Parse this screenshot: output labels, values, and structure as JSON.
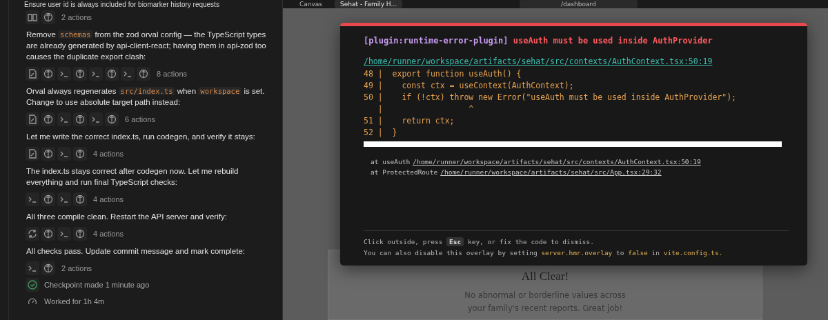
{
  "chat": {
    "title": "Ensure user id is always included for biomarker history requests",
    "feed": [
      {
        "kind": "actions",
        "icons": [
          {
            "kind": "book"
          },
          {
            "kind": "agent"
          }
        ],
        "count": "2 actions"
      },
      {
        "kind": "message",
        "parts": [
          {
            "text": "Remove ",
            "code": false
          },
          {
            "text": "schemas",
            "code": true
          },
          {
            "text": " from the zod orval config — the TypeScript types are already generated by api-client-react; having them in api-zod too causes the duplicate export clash:",
            "code": false
          }
        ]
      },
      {
        "kind": "actions",
        "icons": [
          {
            "kind": "file"
          },
          {
            "kind": "agent"
          },
          {
            "kind": "terminal"
          },
          {
            "kind": "agent"
          },
          {
            "kind": "terminal"
          },
          {
            "kind": "agent"
          },
          {
            "kind": "terminal"
          },
          {
            "kind": "agent"
          }
        ],
        "count": "8 actions"
      },
      {
        "kind": "message",
        "parts": [
          {
            "text": "Orval always regenerates ",
            "code": false
          },
          {
            "text": "src/index.ts",
            "code": true
          },
          {
            "text": " when ",
            "code": false
          },
          {
            "text": "workspace",
            "code": true
          },
          {
            "text": " is set. Change to use absolute target path instead:",
            "code": false
          }
        ]
      },
      {
        "kind": "actions",
        "icons": [
          {
            "kind": "file"
          },
          {
            "kind": "agent"
          },
          {
            "kind": "terminal"
          },
          {
            "kind": "agent"
          },
          {
            "kind": "terminal"
          },
          {
            "kind": "agent"
          }
        ],
        "count": "6 actions"
      },
      {
        "kind": "message",
        "parts": [
          {
            "text": "Let me write the correct index.ts, run codegen, and verify it stays:",
            "code": false
          }
        ]
      },
      {
        "kind": "actions",
        "icons": [
          {
            "kind": "file"
          },
          {
            "kind": "agent"
          },
          {
            "kind": "terminal"
          },
          {
            "kind": "agent"
          }
        ],
        "count": "4 actions"
      },
      {
        "kind": "message",
        "parts": [
          {
            "text": "The index.ts stays correct after codegen now. Let me rebuild everything and run final TypeScript checks:",
            "code": false
          }
        ]
      },
      {
        "kind": "actions",
        "icons": [
          {
            "kind": "terminal"
          },
          {
            "kind": "agent"
          },
          {
            "kind": "terminal"
          },
          {
            "kind": "agent"
          }
        ],
        "count": "4 actions"
      },
      {
        "kind": "message",
        "parts": [
          {
            "text": "All three compile clean. Restart the API server and verify:",
            "code": false
          }
        ]
      },
      {
        "kind": "actions",
        "icons": [
          {
            "kind": "restart"
          },
          {
            "kind": "agent"
          },
          {
            "kind": "terminal"
          },
          {
            "kind": "agent"
          }
        ],
        "count": "4 actions"
      },
      {
        "kind": "message",
        "parts": [
          {
            "text": "All checks pass. Update commit message and mark complete:",
            "code": false
          }
        ]
      },
      {
        "kind": "actions",
        "icons": [
          {
            "kind": "terminal"
          },
          {
            "kind": "agent"
          }
        ],
        "count": "2 actions"
      },
      {
        "kind": "checkpoint",
        "text": "Checkpoint made 1 minute ago"
      },
      {
        "kind": "worked",
        "text": "Worked for 1h 4m"
      }
    ]
  },
  "browser": {
    "tabs": [
      {
        "label": "Canvas",
        "selected": false
      },
      {
        "label": "Sehat - Family H...",
        "selected": true
      }
    ],
    "url": "/dashboard"
  },
  "error_overlay": {
    "plugin": "[plugin:runtime-error-plugin]",
    "message": "useAuth must be used inside AuthProvider",
    "file": "/home/runner/workspace/artifacts/sehat/src/contexts/AuthContext.tsx:50:19",
    "code_lines": [
      "48 |  export function useAuth() {",
      "49 |    const ctx = useContext(AuthContext);",
      "50 |    if (!ctx) throw new Error(\"useAuth must be used inside AuthProvider\");",
      "   |                  ^",
      "51 |    return ctx;",
      "52 |  }"
    ],
    "stack": [
      {
        "at": "at useAuth",
        "link": "/home/runner/workspace/artifacts/sehat/src/contexts/AuthContext.tsx:50:19"
      },
      {
        "at": "at ProtectedRoute",
        "link": "/home/runner/workspace/artifacts/sehat/src/App.tsx:29:32"
      }
    ],
    "tips": [
      [
        {
          "kind": "text",
          "text": "Click outside, press "
        },
        {
          "kind": "kbd",
          "text": "Esc"
        },
        {
          "kind": "text",
          "text": " key, or fix the code to dismiss."
        }
      ],
      [
        {
          "kind": "text",
          "text": "You can also disable this overlay by setting "
        },
        {
          "kind": "code",
          "text": "server.hmr.overlay"
        },
        {
          "kind": "text",
          "text": " to "
        },
        {
          "kind": "code",
          "text": "false"
        },
        {
          "kind": "text",
          "text": " in "
        },
        {
          "kind": "code",
          "text": "vite.config.ts."
        }
      ]
    ]
  },
  "dashboard": {
    "title": "All Clear!",
    "text": "No abnormal or borderline values across your family's recent reports. Great job!"
  }
}
